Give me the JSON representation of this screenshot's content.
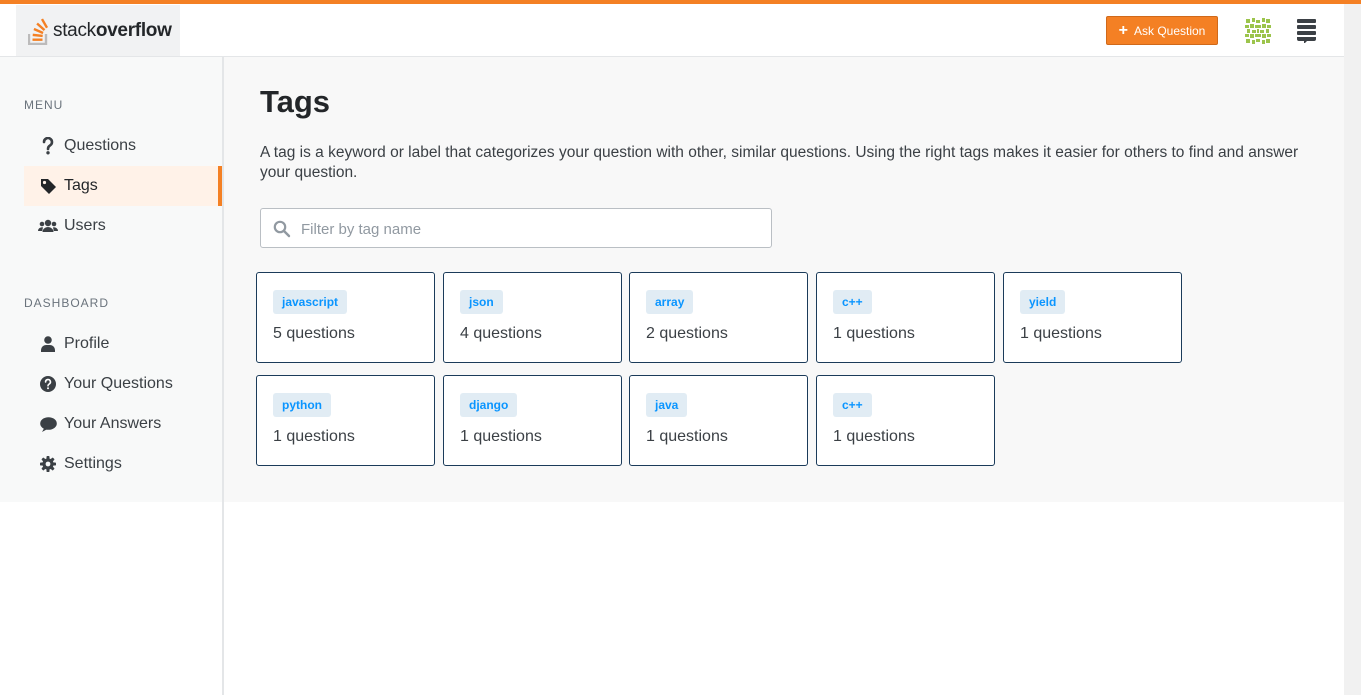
{
  "header": {
    "logo_prefix": "stack",
    "logo_suffix": "overflow",
    "ask_button_label": "Ask Question",
    "brand_color": "#f48024"
  },
  "sidebar": {
    "menu_title": "MENU",
    "menu_items": [
      {
        "label": "Questions",
        "icon": "question-icon"
      },
      {
        "label": "Tags",
        "icon": "tag-icon",
        "active": true
      },
      {
        "label": "Users",
        "icon": "users-icon"
      }
    ],
    "dashboard_title": "DASHBOARD",
    "dashboard_items": [
      {
        "label": "Profile",
        "icon": "user-icon"
      },
      {
        "label": "Your Questions",
        "icon": "question-circle-icon"
      },
      {
        "label": "Your Answers",
        "icon": "comment-icon"
      },
      {
        "label": "Settings",
        "icon": "gear-icon"
      }
    ]
  },
  "main": {
    "title": "Tags",
    "description": "A tag is a keyword or label that categorizes your question with other, similar questions. Using the right tags makes it easier for others to find and answer your question.",
    "search": {
      "placeholder": "Filter by tag name",
      "value": ""
    },
    "tags": [
      {
        "name": "javascript",
        "count": "5 questions"
      },
      {
        "name": "json",
        "count": "4 questions"
      },
      {
        "name": "array",
        "count": "2 questions"
      },
      {
        "name": "c++",
        "count": "1 questions"
      },
      {
        "name": "yield",
        "count": "1 questions"
      },
      {
        "name": "python",
        "count": "1 questions"
      },
      {
        "name": "django",
        "count": "1 questions"
      },
      {
        "name": "java",
        "count": "1 questions"
      },
      {
        "name": "c++",
        "count": "1 questions"
      }
    ]
  }
}
